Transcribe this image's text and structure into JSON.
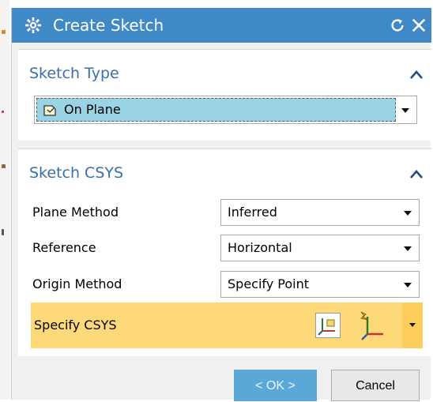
{
  "dialog": {
    "title": "Create Sketch",
    "icons": {
      "app": "gear-icon",
      "reset": "reset-icon",
      "close": "close-icon"
    }
  },
  "sketch_type": {
    "header": "Sketch Type",
    "selected_value": "On Plane",
    "selected_icon": "plane-icon"
  },
  "sketch_csys": {
    "header": "Sketch CSYS",
    "rows": [
      {
        "label": "Plane Method",
        "value": "Inferred"
      },
      {
        "label": "Reference",
        "value": "Horizontal"
      },
      {
        "label": "Origin Method",
        "value": "Specify Point"
      }
    ],
    "specify_label": "Specify CSYS",
    "specify_icons": [
      "csys-dialog-icon",
      "inferred-csys-icon"
    ]
  },
  "buttons": {
    "ok": "< OK >",
    "cancel": "Cancel"
  },
  "colors": {
    "titlebar": "#3f89c6",
    "section_header": "#3a6fa8",
    "selection": "#9ad3e3",
    "highlight_row": "#fdd97a",
    "ok_button": "#5aa8d8"
  }
}
